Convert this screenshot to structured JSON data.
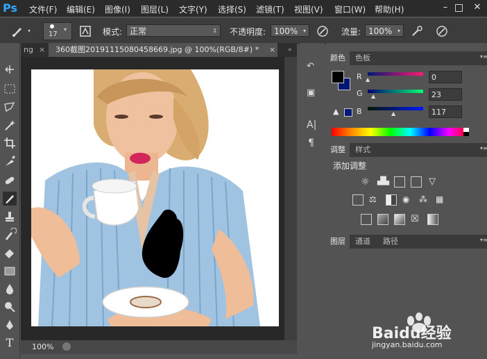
{
  "app": {
    "logo": "Ps"
  },
  "menu": [
    "文件(F)",
    "编辑(E)",
    "图像(I)",
    "图层(L)",
    "文字(Y)",
    "选择(S)",
    "滤镜(T)",
    "视图(V)",
    "窗口(W)",
    "帮助(H)"
  ],
  "options": {
    "brush_size": "17",
    "mode_label": "模式:",
    "mode_value": "正常",
    "opacity_label": "不透明度:",
    "opacity_value": "100%",
    "flow_label": "流量:",
    "flow_value": "100%"
  },
  "document": {
    "prev_tab": "ng",
    "tab_title": "360截图20191115080458669.jpg @ 100%(RGB/8#) *",
    "zoom": "100%"
  },
  "color_panel": {
    "tabs": [
      "颜色",
      "色板"
    ],
    "r_label": "R",
    "r_value": "0",
    "g_label": "G",
    "g_value": "23",
    "b_label": "B",
    "b_value": "117",
    "foreground": "#001775",
    "background": "#ffffff"
  },
  "adjust_panel": {
    "tabs": [
      "调整",
      "样式"
    ],
    "title": "添加调整"
  },
  "layers_panel": {
    "tabs": [
      "图层",
      "通道",
      "路径"
    ]
  },
  "watermark": {
    "brand": "Baidu经验",
    "url": "jingyan.baidu.com"
  }
}
